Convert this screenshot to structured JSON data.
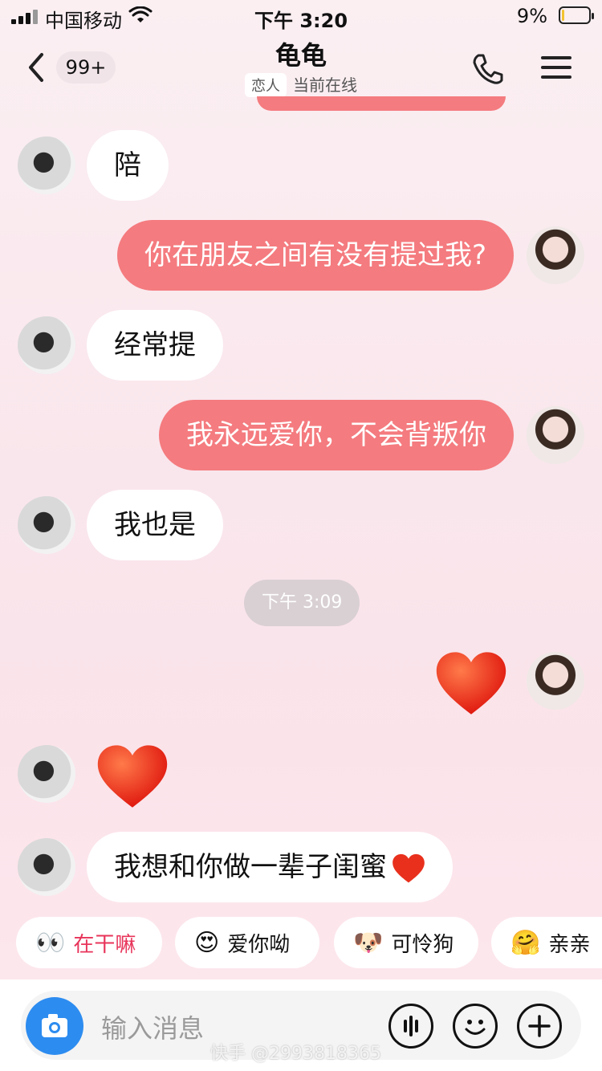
{
  "status_bar": {
    "carrier": "中国移动",
    "time": "下午 3:20",
    "battery": "9%",
    "battery_level": 0.09
  },
  "header": {
    "back_badge": "99+",
    "title": "龟龟",
    "relation_tag": "恋人",
    "online_status": "当前在线"
  },
  "messages": [
    {
      "side": "in",
      "type": "text",
      "text": "陪"
    },
    {
      "side": "out",
      "type": "text",
      "text": "你在朋友之间有没有提过我?"
    },
    {
      "side": "in",
      "type": "text",
      "text": "经常提"
    },
    {
      "side": "out",
      "type": "text",
      "text": "我永远爱你，不会背叛你"
    },
    {
      "side": "in",
      "type": "text",
      "text": "我也是"
    },
    {
      "type": "timestamp",
      "text": "下午 3:09"
    },
    {
      "side": "out",
      "type": "emoji",
      "icon": "red-heart-icon"
    },
    {
      "side": "in",
      "type": "emoji",
      "icon": "red-heart-icon"
    },
    {
      "side": "in",
      "type": "text",
      "text": "我想和你做一辈子闺蜜"
    }
  ],
  "quick_replies": [
    {
      "label": "在干嘛",
      "emoji": "👀"
    },
    {
      "label": "爱你呦",
      "emoji": "😍"
    },
    {
      "label": "可怜狗",
      "emoji": "🐶"
    },
    {
      "label": "亲亲",
      "emoji": "🤗"
    }
  ],
  "input": {
    "placeholder": "输入消息"
  },
  "watermark": "快手 @2993818365",
  "colors": {
    "accent": "#f47b7f",
    "camera": "#2d8cf0",
    "quick_first": "#e8345a"
  }
}
